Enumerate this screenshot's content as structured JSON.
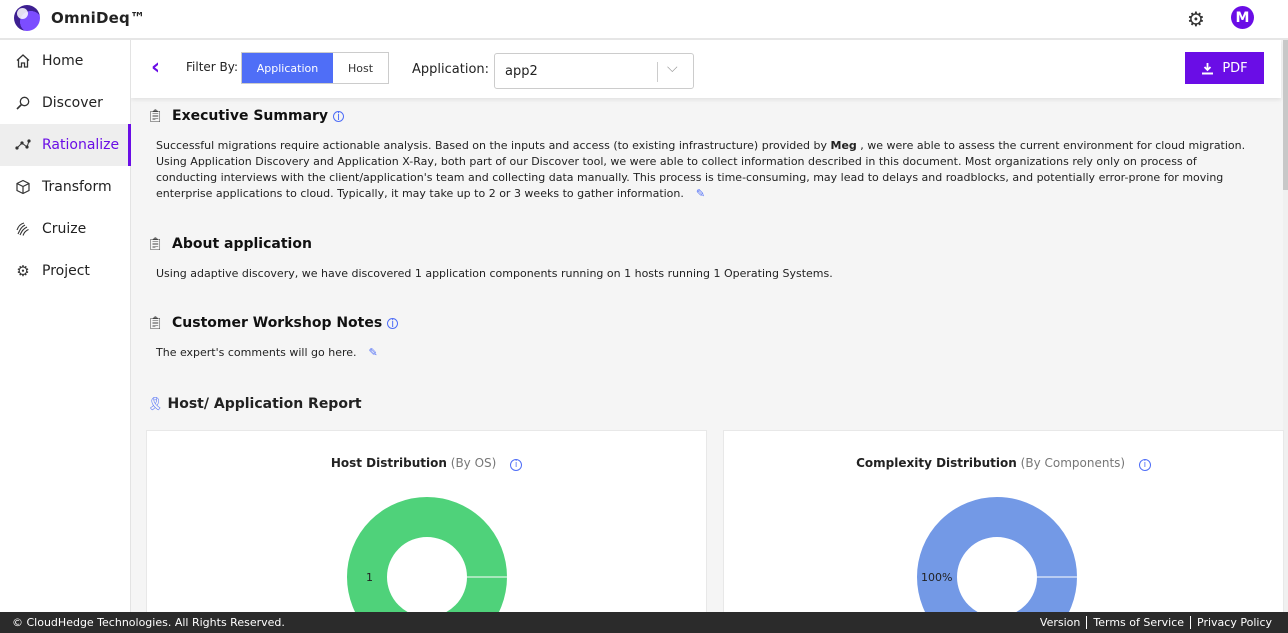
{
  "app": {
    "brand": "OmniDeq™"
  },
  "sidebar": {
    "items": [
      {
        "label": "Home",
        "icon": "home-icon"
      },
      {
        "label": "Discover",
        "icon": "discover-icon"
      },
      {
        "label": "Rationalize",
        "icon": "rationalize-icon",
        "active": true
      },
      {
        "label": "Transform",
        "icon": "cube-icon"
      },
      {
        "label": "Cruize",
        "icon": "fingerprint-icon"
      },
      {
        "label": "Project",
        "icon": "gear-icon"
      }
    ]
  },
  "header": {
    "avatar_initial": "M"
  },
  "filter": {
    "label": "Filter By:",
    "options": [
      "Application",
      "Host"
    ],
    "selected": "Application",
    "application_label": "Application:",
    "application_value": "app2",
    "pdf_label": "PDF"
  },
  "sections": {
    "executive": {
      "title": "Executive Summary",
      "text_before": "Successful migrations require actionable analysis. Based on the inputs and access (to existing infrastructure) provided by ",
      "text_bold": "Meg",
      "text_after": " , we were able to assess the current environment for cloud migration. Using Application Discovery and Application X-Ray, both part of our Discover tool, we were able to collect information described in this document. Most organizations rely only on process of conducting interviews with the client/application's team and collecting data manually. This process is time-consuming, may lead to delays and roadblocks, and potentially error-prone for moving enterprise applications to cloud. Typically, it may take up to 2 or 3 weeks to gather information."
    },
    "about": {
      "title": "About application",
      "text": "Using adaptive discovery, we have discovered 1 application components running on 1 hosts running 1 Operating Systems."
    },
    "workshop": {
      "title": "Customer Workshop Notes",
      "text": "The expert's comments will go here."
    }
  },
  "report": {
    "title": "Host/ Application Report",
    "cards": [
      {
        "title": "Host Distribution",
        "subtitle": "(By OS)",
        "value_label": "1",
        "color": "#4fd27a"
      },
      {
        "title": "Complexity Distribution",
        "subtitle": "(By Components)",
        "value_label": "100%",
        "color": "#7399e6"
      }
    ]
  },
  "footer": {
    "copyright": "© CloudHedge Technologies. All Rights Reserved.",
    "links": [
      "Version",
      "Terms of Service",
      "Privacy Policy"
    ]
  }
}
